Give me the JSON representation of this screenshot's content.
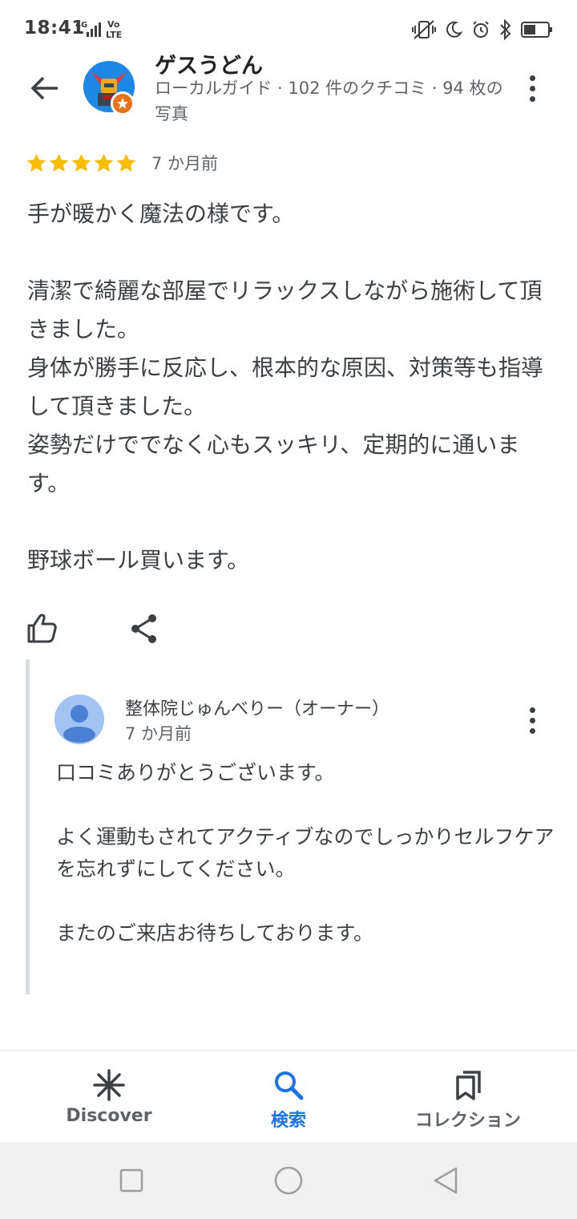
{
  "status_bar": {
    "time": "18:41",
    "network": "4G",
    "volte": "Vo LTE"
  },
  "header": {
    "reviewer_name": "ゲスうどん",
    "reviewer_meta": "ローカルガイド · 102 件のクチコミ · 94 枚の写真"
  },
  "review": {
    "rating": 5,
    "date": "7 か月前",
    "text": "手が暖かく魔法の様です。\n\n清潔で綺麗な部屋でリラックスしながら施術して頂きました。\n身体が勝手に反応し、根本的な原因、対策等も指導して頂きました。\n姿勢だけででなく心もスッキリ、定期的に通います。\n\n野球ボール買います。"
  },
  "owner_reply": {
    "name": "整体院じゅんべりー（オーナー）",
    "date": "7 か月前",
    "text": "口コミありがとうございます。\n\nよく運動もされてアクティブなのでしっかりセルフケアを忘れずにしてください。\n\nまたのご来店お待ちしております。"
  },
  "bottom_nav": {
    "items": [
      {
        "label": "Discover",
        "icon": "discover-icon",
        "active": false
      },
      {
        "label": "検索",
        "icon": "search-icon",
        "active": true
      },
      {
        "label": "コレクション",
        "icon": "collection-icon",
        "active": false
      }
    ]
  },
  "colors": {
    "star": "#fbbc04",
    "active_nav": "#1a73e8",
    "reply_bar": "#dadce0"
  }
}
